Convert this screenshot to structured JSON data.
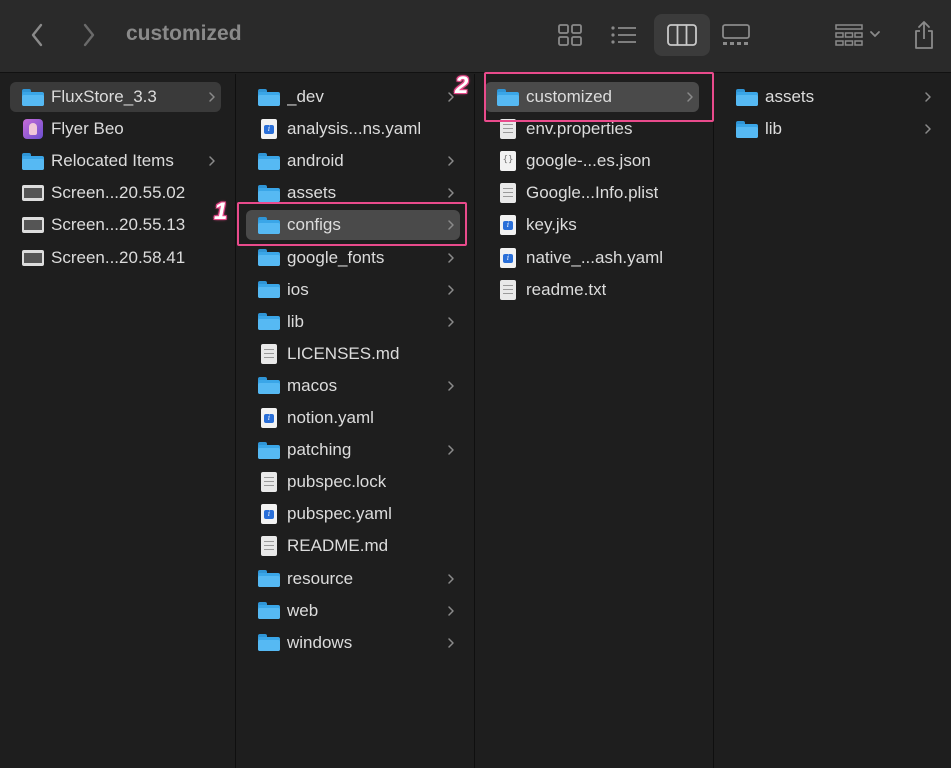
{
  "toolbar": {
    "title": "customized",
    "back_icon": "chevron-left-icon",
    "forward_icon": "chevron-right-icon",
    "views": [
      "icon-view-icon",
      "list-view-icon",
      "column-view-icon",
      "gallery-view-icon"
    ],
    "active_view": "column-view-icon",
    "group_icon": "group-grid-icon",
    "share_icon": "share-icon"
  },
  "columns": [
    {
      "items": [
        {
          "label": "FluxStore_3.3",
          "icon": "folder",
          "chevron": true,
          "selected": true
        },
        {
          "label": "Flyer Beo",
          "icon": "app",
          "chevron": false
        },
        {
          "label": "Relocated Items",
          "icon": "folder",
          "chevron": true
        },
        {
          "label": "Screen...20.55.02",
          "icon": "screenshot",
          "chevron": false
        },
        {
          "label": "Screen...20.55.13",
          "icon": "screenshot",
          "chevron": false
        },
        {
          "label": "Screen...20.58.41",
          "icon": "screenshot",
          "chevron": false
        }
      ]
    },
    {
      "items": [
        {
          "label": "_dev",
          "icon": "folder",
          "chevron": true
        },
        {
          "label": "analysis...ns.yaml",
          "icon": "yaml",
          "chevron": false
        },
        {
          "label": "android",
          "icon": "folder",
          "chevron": true
        },
        {
          "label": "assets",
          "icon": "folder",
          "chevron": true
        },
        {
          "label": "configs",
          "icon": "folder",
          "chevron": true,
          "selected": true
        },
        {
          "label": "google_fonts",
          "icon": "folder",
          "chevron": true
        },
        {
          "label": "ios",
          "icon": "folder",
          "chevron": true
        },
        {
          "label": "lib",
          "icon": "folder",
          "chevron": true
        },
        {
          "label": "LICENSES.md",
          "icon": "doc",
          "chevron": false
        },
        {
          "label": "macos",
          "icon": "folder",
          "chevron": true
        },
        {
          "label": "notion.yaml",
          "icon": "yaml",
          "chevron": false
        },
        {
          "label": "patching",
          "icon": "folder",
          "chevron": true
        },
        {
          "label": "pubspec.lock",
          "icon": "doc",
          "chevron": false
        },
        {
          "label": "pubspec.yaml",
          "icon": "yaml",
          "chevron": false
        },
        {
          "label": "README.md",
          "icon": "doc",
          "chevron": false
        },
        {
          "label": "resource",
          "icon": "folder",
          "chevron": true
        },
        {
          "label": "web",
          "icon": "folder",
          "chevron": true
        },
        {
          "label": "windows",
          "icon": "folder",
          "chevron": true
        }
      ]
    },
    {
      "items": [
        {
          "label": "customized",
          "icon": "folder",
          "chevron": true,
          "selected": true
        },
        {
          "label": "env.properties",
          "icon": "doc",
          "chevron": false
        },
        {
          "label": "google-...es.json",
          "icon": "json",
          "chevron": false
        },
        {
          "label": "Google...Info.plist",
          "icon": "doc",
          "chevron": false
        },
        {
          "label": "key.jks",
          "icon": "yaml",
          "chevron": false
        },
        {
          "label": "native_...ash.yaml",
          "icon": "yaml",
          "chevron": false
        },
        {
          "label": "readme.txt",
          "icon": "doc",
          "chevron": false
        }
      ]
    },
    {
      "items": [
        {
          "label": "assets",
          "icon": "folder",
          "chevron": true
        },
        {
          "label": "lib",
          "icon": "folder",
          "chevron": true
        }
      ]
    }
  ],
  "annotations": [
    {
      "number": "1",
      "target": "configs"
    },
    {
      "number": "2",
      "target": "customized"
    }
  ],
  "colors": {
    "highlight": "#e94b8c",
    "folder": "#3aa6e8",
    "background": "#1e1e1e"
  }
}
